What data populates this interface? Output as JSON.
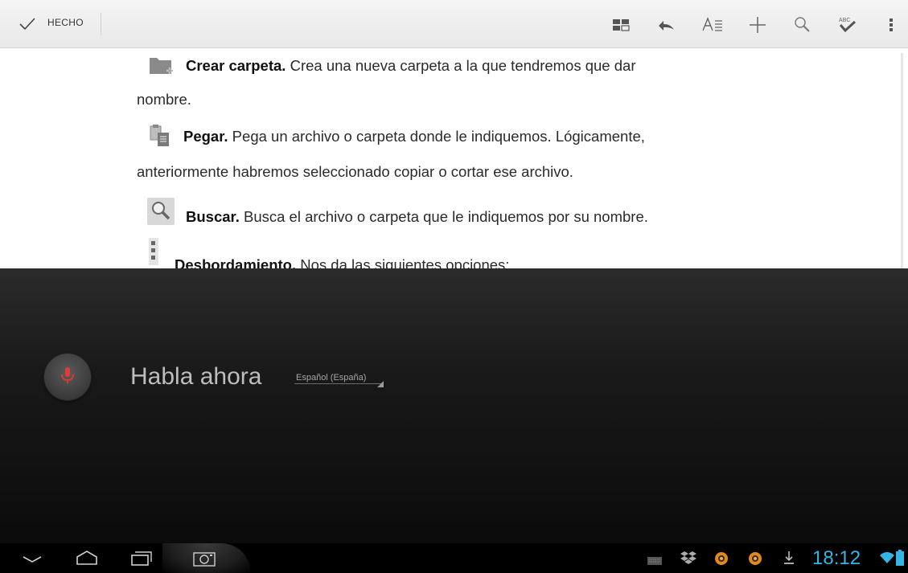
{
  "actionbar": {
    "done_label": "HECHO",
    "icons": [
      "view-layout-icon",
      "undo-icon",
      "text-format-icon",
      "add-icon",
      "search-icon",
      "spellcheck-icon",
      "overflow-menu-icon"
    ],
    "spellcheck_text": "ABC"
  },
  "document": {
    "paragraphs": [
      {
        "icon": "new-folder-icon",
        "bold": "Crear carpeta.",
        "text": " Crea una nueva carpeta a la que tendremos que dar",
        "continuation": "nombre."
      },
      {
        "icon": "paste-icon",
        "bold": "Pegar.",
        "text": " Pega un archivo o carpeta donde le indiquemos. Lógicamente,",
        "continuation": "anteriormente habremos seleccionado copiar o cortar ese archivo."
      },
      {
        "icon": "search-icon",
        "bold": "Buscar.",
        "text": " Busca el archivo o carpeta que le indiquemos por su nombre."
      },
      {
        "icon": "overflow-icon",
        "bold": "Desbordamiento.",
        "text": " Nos da las siguientes opciones:"
      }
    ]
  },
  "voice": {
    "prompt": "Habla ahora",
    "language": "Español (España)",
    "mic_color": "#e53935"
  },
  "systembar": {
    "nav": [
      "hide-keyboard-icon",
      "home-icon",
      "recent-apps-icon",
      "screenshot-icon"
    ],
    "tray": [
      "keyboard-icon",
      "dropbox-icon",
      "app-notification-icon",
      "app-notification-icon",
      "download-icon"
    ],
    "clock": "18:12",
    "accent": "#33b5e5"
  }
}
